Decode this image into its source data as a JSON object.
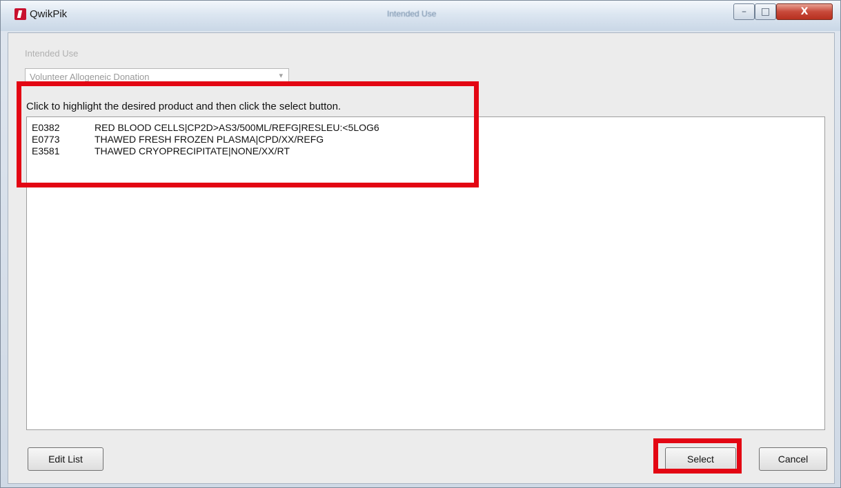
{
  "window": {
    "app_title": "QwikPik",
    "center_title": "Intended Use",
    "controls": {
      "minimize": "–",
      "maximize": "□",
      "close": "X"
    }
  },
  "intended_use": {
    "label": "Intended Use",
    "selected": "Volunteer Allogeneic Donation"
  },
  "instruction": "Click to highlight the desired product and then click the select button.",
  "products": [
    {
      "code": "E0382",
      "description": "RED BLOOD CELLS|CP2D>AS3/500ML/REFG|RESLEU:<5LOG6"
    },
    {
      "code": "E0773",
      "description": "THAWED FRESH FROZEN PLASMA|CPD/XX/REFG"
    },
    {
      "code": "E3581",
      "description": "THAWED CRYOPRECIPITATE|NONE/XX/RT"
    }
  ],
  "buttons": {
    "edit_list": "Edit List",
    "select": "Select",
    "cancel": "Cancel"
  },
  "annotation_color": "#e30613"
}
